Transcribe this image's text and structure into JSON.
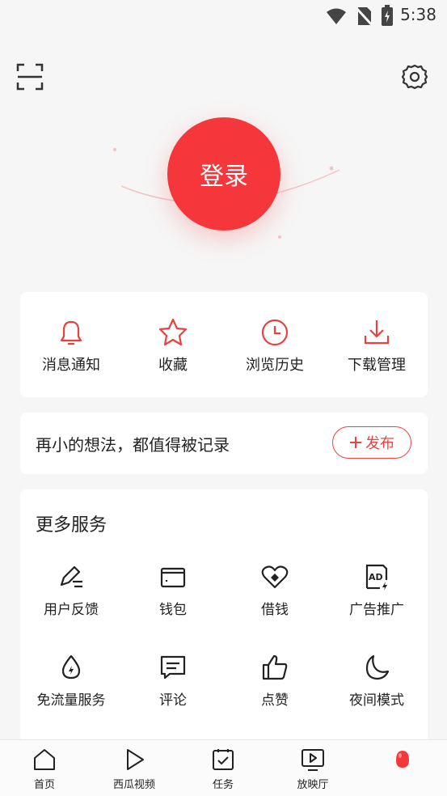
{
  "status_bar": {
    "time": "5:38"
  },
  "header": {
    "login_label": "登录"
  },
  "quick_actions": [
    {
      "label": "消息通知",
      "icon": "bell-icon"
    },
    {
      "label": "收藏",
      "icon": "star-icon"
    },
    {
      "label": "浏览历史",
      "icon": "clock-icon"
    },
    {
      "label": "下载管理",
      "icon": "download-icon"
    }
  ],
  "post_bar": {
    "slogan": "再小的想法，都值得被记录",
    "publish_label": "发布"
  },
  "more_services": {
    "title": "更多服务",
    "items": [
      {
        "label": "用户反馈",
        "icon": "pen-icon"
      },
      {
        "label": "钱包",
        "icon": "wallet-icon"
      },
      {
        "label": "借钱",
        "icon": "loan-icon"
      },
      {
        "label": "广告推广",
        "icon": "ad-icon"
      },
      {
        "label": "免流量服务",
        "icon": "water-drop-icon"
      },
      {
        "label": "评论",
        "icon": "comment-icon"
      },
      {
        "label": "点赞",
        "icon": "thumbs-up-icon"
      },
      {
        "label": "夜间模式",
        "icon": "moon-icon"
      }
    ]
  },
  "bottom_nav": [
    {
      "label": "首页",
      "icon": "home-icon"
    },
    {
      "label": "西瓜视频",
      "icon": "play-icon"
    },
    {
      "label": "任务",
      "icon": "task-icon"
    },
    {
      "label": "放映厅",
      "icon": "tv-icon"
    },
    {
      "label": "",
      "icon": "egg-icon"
    }
  ],
  "colors": {
    "accent": "#f5373b",
    "icon_red": "#e64340"
  }
}
